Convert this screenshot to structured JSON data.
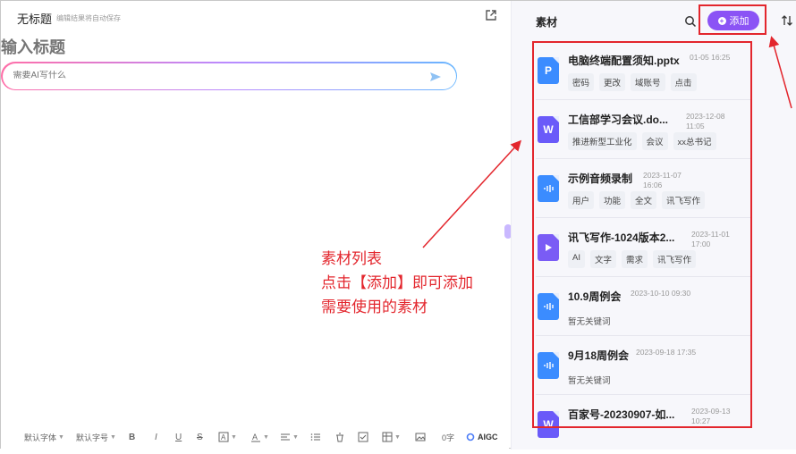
{
  "editor": {
    "doc_title": "无标题",
    "autosave_hint": "编辑结果将自动保存",
    "title_placeholder": "输入标题",
    "ai_placeholder": "需要AI写什么"
  },
  "toolbar": {
    "font_family": "默认字体",
    "font_size": "默认字号",
    "bold": "B",
    "italic": "I",
    "underline": "U",
    "strike": "S",
    "word_count": "0字",
    "aigc": "AIGC"
  },
  "panel": {
    "title": "素材",
    "add_label": "添加",
    "items": [
      {
        "type": "ppt",
        "icon_letter": "P",
        "name": "电脑终端配置须知.pptx",
        "date": "01-05 16:25",
        "tags": [
          "密码",
          "更改",
          "域账号",
          "点击"
        ]
      },
      {
        "type": "word",
        "icon_letter": "W",
        "name": "工信部学习会议.do...",
        "date": "2023-12-08 11:05",
        "tags": [
          "推进新型工业化",
          "会议",
          "xx总书记"
        ]
      },
      {
        "type": "audio",
        "icon_letter": "",
        "name": "示例音频录制",
        "date": "2023-11-07 16:06",
        "tags": [
          "用户",
          "功能",
          "全文",
          "讯飞写作"
        ]
      },
      {
        "type": "video",
        "icon_letter": "",
        "name": "讯飞写作-1024版本2...",
        "date": "2023-11-01 17:00",
        "tags": [
          "AI",
          "文字",
          "需求",
          "讯飞写作"
        ]
      },
      {
        "type": "audio",
        "icon_letter": "",
        "name": "10.9周例会",
        "date": "2023-10-10 09:30",
        "no_keywords": "暂无关键词"
      },
      {
        "type": "audio",
        "icon_letter": "",
        "name": "9月18周例会",
        "date": "2023-09-18 17:35",
        "no_keywords": "暂无关键词"
      },
      {
        "type": "word",
        "icon_letter": "W",
        "name": "百家号-20230907-如...",
        "date": "2023-09-13 10:27"
      }
    ]
  },
  "annotation": {
    "text": "素材列表\n点击【添加】即可添加\n需要使用的素材",
    "color": "#e3262d"
  },
  "colors": {
    "accent": "#8b53f5",
    "annotation_red": "#e3262d"
  }
}
